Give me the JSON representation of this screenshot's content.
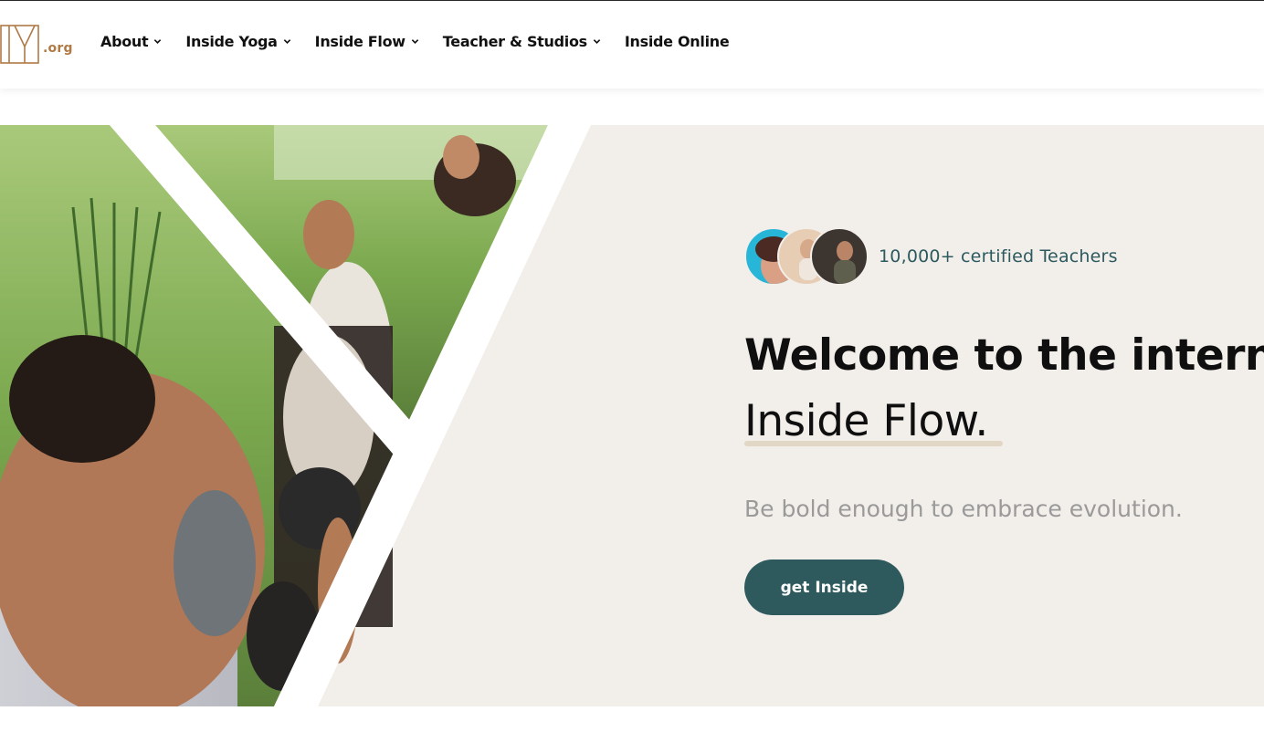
{
  "brand": {
    "logo_text": ".org",
    "logo_icon": "iy-monogram-icon"
  },
  "nav": {
    "items": [
      {
        "label": "About",
        "has_dropdown": true
      },
      {
        "label": "Inside Yoga",
        "has_dropdown": true
      },
      {
        "label": "Inside Flow",
        "has_dropdown": true
      },
      {
        "label": "Teacher & Studios",
        "has_dropdown": true
      },
      {
        "label": "Inside Online",
        "has_dropdown": false
      }
    ]
  },
  "hero": {
    "teachers_text": "10,000+ certified Teachers",
    "headline": "Welcome to the interna",
    "subheadline": "Inside Flow.",
    "tagline": "Be bold enough to embrace evolution.",
    "cta_label": "get Inside"
  },
  "colors": {
    "accent": "#2e5a5e",
    "logo": "#b07a45",
    "hero_background": "#f2eeea",
    "underline": "#e2d6c4"
  }
}
